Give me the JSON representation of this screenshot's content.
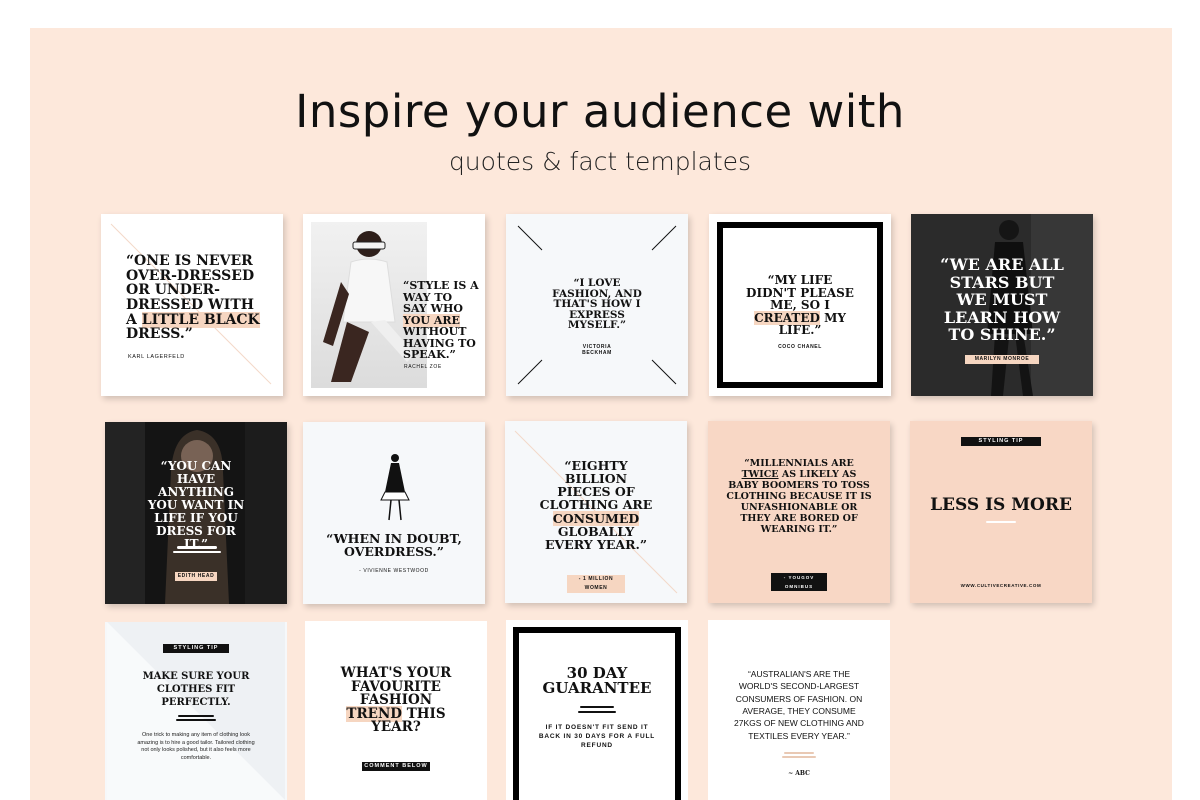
{
  "header": {
    "title": "Inspire your audience with",
    "subtitle": "quotes & fact templates"
  },
  "colors": {
    "peach": "#fde8db",
    "highlight": "#f6d6c1",
    "ink": "#111111"
  },
  "cards": {
    "c1": {
      "q_a": "“One is never over-dressed or under-dressed with a ",
      "q_hl": "little black",
      "q_b": " dress.”",
      "attr": "Karl Lagerfeld"
    },
    "c2": {
      "q_a": "“Style is a way to say who ",
      "q_hl": "you are",
      "q_b": " without having to speak.”",
      "attr": "Rachel Zoe"
    },
    "c3": {
      "q": "“I love fashion, and that's how I express myself.”",
      "attr": "Victoria Beckham"
    },
    "c4": {
      "q_a": "“My life didn't please me, so I ",
      "q_hl": "created",
      "q_b": " my life.”",
      "attr": "Coco Chanel"
    },
    "c5": {
      "q": "“We are all stars but we must learn how to shine.”",
      "attr": "Marilyn Monroe"
    },
    "c6": {
      "q": "“You can have anything you want in life if you dress for it.”",
      "attr": "Edith Head"
    },
    "c7": {
      "q": "“When in doubt, overdress.”",
      "attr": "- Vivienne Westwood"
    },
    "c8": {
      "q_a": "“Eighty billion pieces of clothing are ",
      "q_hl": "consumed",
      "q_b": " globally every year.”",
      "attr": "- 1 Million Women"
    },
    "c9": {
      "q_a": "“Millennials are ",
      "q_ul": "twice",
      "q_b": " as likely as baby boomers to toss clothing because it is unfashionable or they are bored of wearing it.”",
      "attr": "- YouGov Omnibus"
    },
    "c10": {
      "tag": "Styling Tip",
      "q": "Less is more",
      "url": "www.cultivecreative.com"
    },
    "c11": {
      "tag": "Styling Tip",
      "title": "Make sure your clothes fit perfectly.",
      "body": "One trick to making any item of clothing look amazing is to hire a good tailor. Tailored clothing not only looks polished, but it also feels more comfortable."
    },
    "c12": {
      "q_a": "What's your favourite fashion ",
      "q_hl": "trend",
      "q_b": " this year?",
      "cta": "Comment Below"
    },
    "c13": {
      "title": "30 Day Guarantee",
      "body": "If it doesn't fit send it back in 30 days for a full refund"
    },
    "c14": {
      "q": "“Australian's are the world's second-largest consumers of fashion. On average, they consume 27kgs of new clothing and textiles every year.”",
      "attr": "~ ABC"
    }
  }
}
